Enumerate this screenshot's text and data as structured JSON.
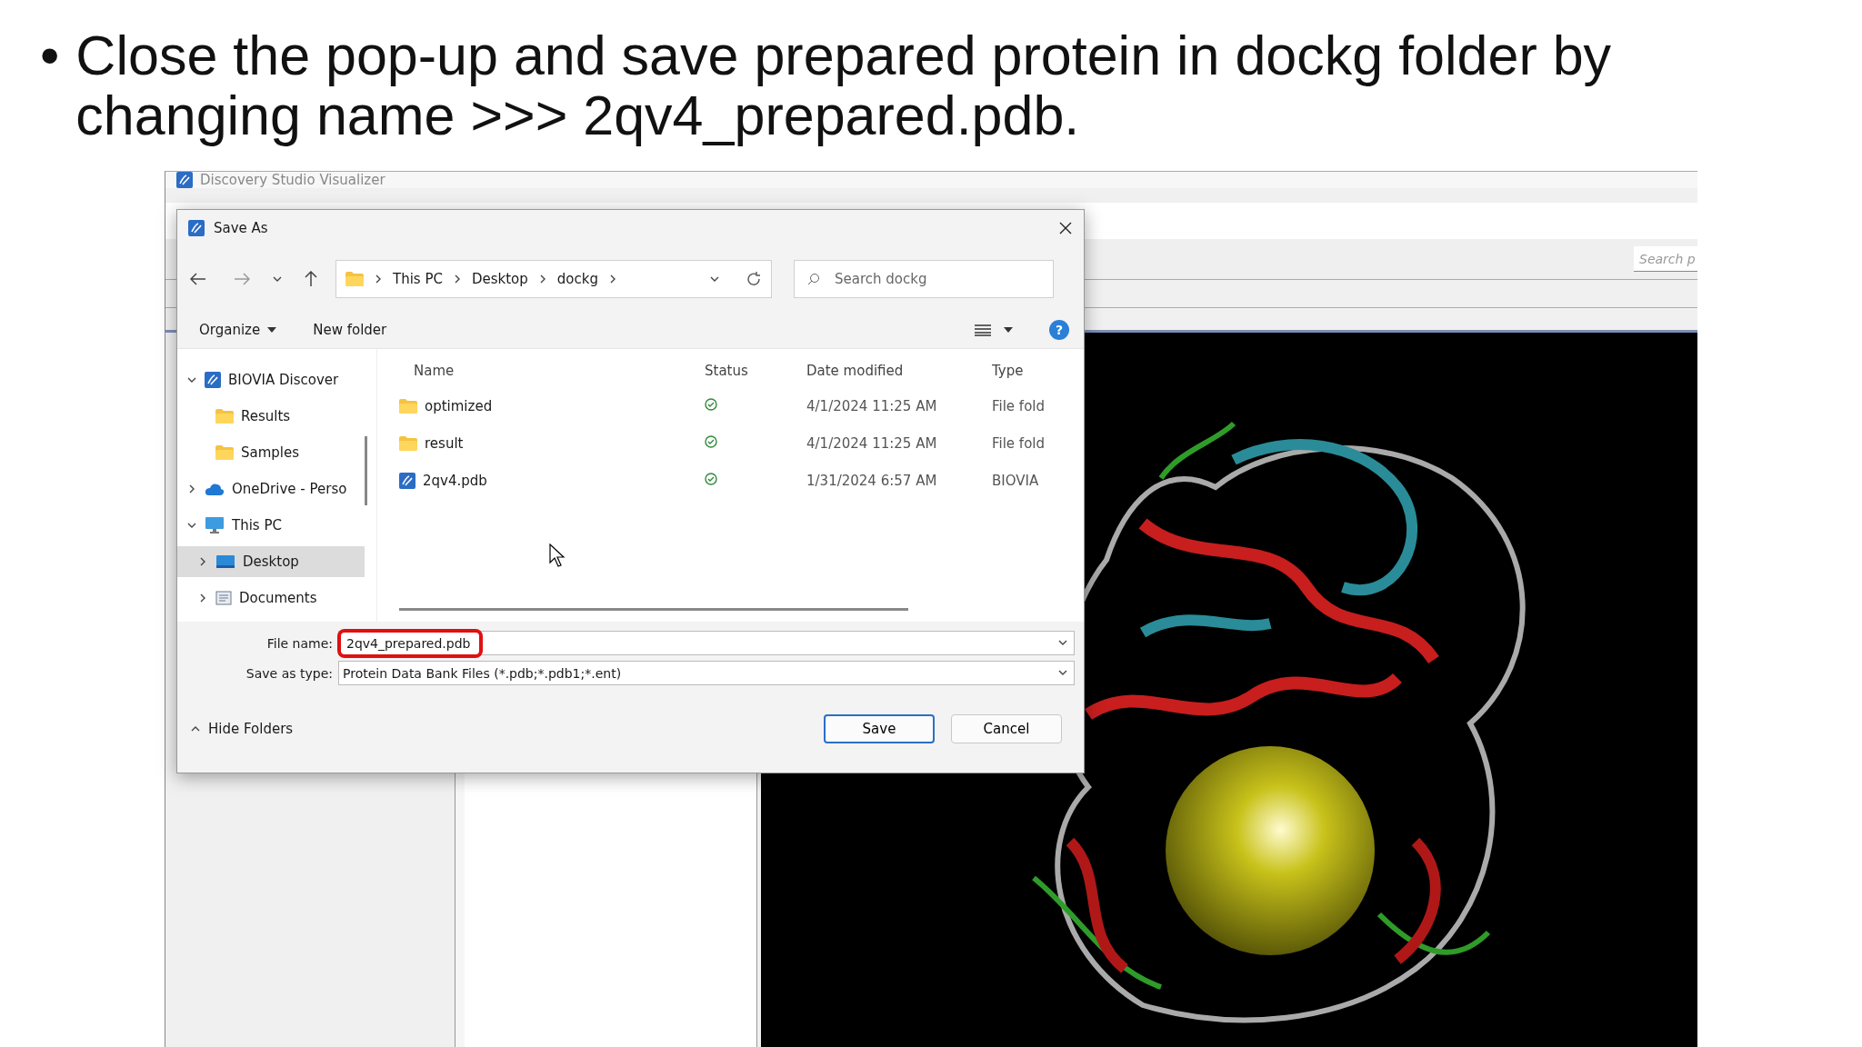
{
  "slide": {
    "bullet": "•",
    "text": "Close the pop-up and save prepared protein in dockg folder by changing name >>> 2qv4_prepared.pdb."
  },
  "app": {
    "title": "Discovery Studio Visualizer",
    "search_placeholder": "Search p"
  },
  "dialog": {
    "title": "Save As",
    "breadcrumb": [
      "This PC",
      "Desktop",
      "dockg"
    ],
    "search": {
      "placeholder": "Search dockg"
    },
    "commands": [
      "Organize",
      "New folder"
    ],
    "help": "?",
    "tree": [
      {
        "label": "BIOVIA Discover",
        "kind": "app",
        "expanded": true,
        "selected": false,
        "children": [
          {
            "label": "Results",
            "kind": "folder",
            "selected": false
          },
          {
            "label": "Samples",
            "kind": "folder",
            "selected": false
          }
        ]
      },
      {
        "label": "OneDrive - Perso",
        "kind": "cloud",
        "expanded": false,
        "selected": false
      },
      {
        "label": "This PC",
        "kind": "pc",
        "expanded": true,
        "selected": false,
        "children": [
          {
            "label": "Desktop",
            "kind": "desktop",
            "expanded": false,
            "selected": true
          },
          {
            "label": "Documents",
            "kind": "documents",
            "expanded": false,
            "selected": false
          }
        ]
      }
    ],
    "columns": [
      "Name",
      "Status",
      "Date modified",
      "Type"
    ],
    "files": [
      {
        "name": "optimized",
        "kind": "folder",
        "synced": true,
        "date": "4/1/2024 11:25 AM",
        "type": "File fold"
      },
      {
        "name": "result",
        "kind": "folder",
        "synced": true,
        "date": "4/1/2024 11:25 AM",
        "type": "File fold"
      },
      {
        "name": "2qv4.pdb",
        "kind": "app",
        "synced": true,
        "date": "1/31/2024 6:57 AM",
        "type": "BIOVIA"
      }
    ],
    "file_name": {
      "label": "File name:",
      "value": "2qv4_prepared.pdb",
      "highlighted": true
    },
    "save_as_type": {
      "label": "Save as type:",
      "value": "Protein Data Bank Files (*.pdb;*.pdb1;*.ent)"
    },
    "hide_folders": "Hide Folders",
    "buttons": [
      {
        "label": "Save",
        "default": true
      },
      {
        "label": "Cancel",
        "default": false
      }
    ]
  }
}
